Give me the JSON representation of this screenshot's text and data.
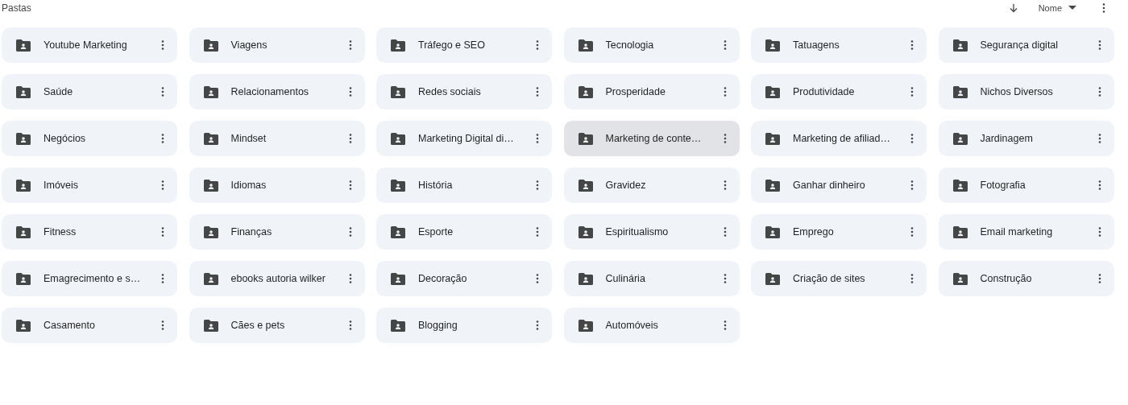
{
  "header": {
    "title": "Pastas",
    "sort_label": "Nome"
  },
  "folders": [
    {
      "name": "Youtube Marketing",
      "selected": false
    },
    {
      "name": "Viagens",
      "selected": false
    },
    {
      "name": "Tráfego e SEO",
      "selected": false
    },
    {
      "name": "Tecnologia",
      "selected": false
    },
    {
      "name": "Tatuagens",
      "selected": false
    },
    {
      "name": "Segurança digital",
      "selected": false
    },
    {
      "name": "Saúde",
      "selected": false
    },
    {
      "name": "Relacionamentos",
      "selected": false
    },
    {
      "name": "Redes sociais",
      "selected": false
    },
    {
      "name": "Prosperidade",
      "selected": false
    },
    {
      "name": "Produtividade",
      "selected": false
    },
    {
      "name": "Nichos Diversos",
      "selected": false
    },
    {
      "name": "Negócios",
      "selected": false
    },
    {
      "name": "Mindset",
      "selected": false
    },
    {
      "name": "Marketing Digital di…",
      "selected": false
    },
    {
      "name": "Marketing de conte…",
      "selected": true
    },
    {
      "name": "Marketing de afiliad…",
      "selected": false
    },
    {
      "name": "Jardinagem",
      "selected": false
    },
    {
      "name": "Imóveis",
      "selected": false
    },
    {
      "name": "Idiomas",
      "selected": false
    },
    {
      "name": "História",
      "selected": false
    },
    {
      "name": "Gravidez",
      "selected": false
    },
    {
      "name": "Ganhar dinheiro",
      "selected": false
    },
    {
      "name": "Fotografia",
      "selected": false
    },
    {
      "name": "Fitness",
      "selected": false
    },
    {
      "name": "Finanças",
      "selected": false
    },
    {
      "name": "Esporte",
      "selected": false
    },
    {
      "name": "Espiritualismo",
      "selected": false
    },
    {
      "name": "Emprego",
      "selected": false
    },
    {
      "name": "Email marketing",
      "selected": false
    },
    {
      "name": "Emagrecimento e s…",
      "selected": false
    },
    {
      "name": "ebooks autoria wilker",
      "selected": false
    },
    {
      "name": "Decoração",
      "selected": false
    },
    {
      "name": "Culinária",
      "selected": false
    },
    {
      "name": "Criação de sites",
      "selected": false
    },
    {
      "name": "Construção",
      "selected": false
    },
    {
      "name": "Casamento",
      "selected": false
    },
    {
      "name": "Cães e pets",
      "selected": false
    },
    {
      "name": "Blogging",
      "selected": false
    },
    {
      "name": "Automóveis",
      "selected": false
    }
  ]
}
